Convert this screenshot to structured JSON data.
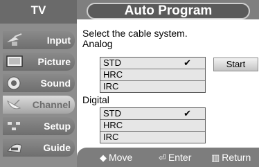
{
  "sidebar": {
    "title": "TV",
    "items": [
      {
        "label": "Input",
        "icon": "antenna-icon"
      },
      {
        "label": "Picture",
        "icon": "picture-icon"
      },
      {
        "label": "Sound",
        "icon": "speaker-icon"
      },
      {
        "label": "Channel",
        "icon": "satellite-dish-icon"
      },
      {
        "label": "Setup",
        "icon": "setup-icon"
      },
      {
        "label": "Guide",
        "icon": "guide-icon"
      }
    ],
    "active_item": "Channel"
  },
  "main": {
    "title": "Auto Program",
    "instruction": "Select the cable system.",
    "analog": {
      "label": "Analog",
      "options": [
        "STD",
        "HRC",
        "IRC"
      ],
      "checked": "STD",
      "check_mark": "✔"
    },
    "digital": {
      "label": "Digital",
      "options": [
        "STD",
        "HRC",
        "IRC"
      ],
      "checked": "STD",
      "check_mark": "✔"
    },
    "start_button": "Start"
  },
  "footer": {
    "move": {
      "symbol": "◆",
      "label": "Move"
    },
    "enter": {
      "symbol": "⏎",
      "label": "Enter"
    },
    "return": {
      "symbol": "▥",
      "label": "Return"
    }
  }
}
